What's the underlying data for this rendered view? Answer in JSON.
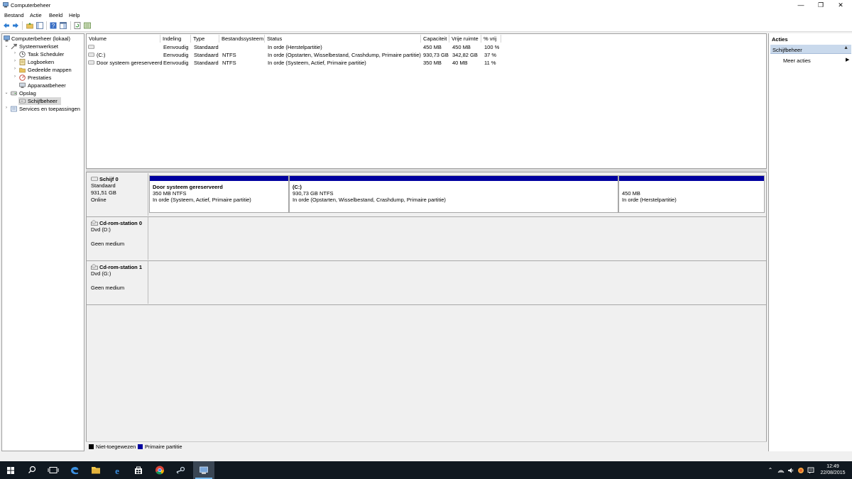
{
  "window": {
    "title": "Computerbeheer",
    "minimize_glyph": "—",
    "maximize_glyph": "❐",
    "close_glyph": "✕"
  },
  "menu": [
    "Bestand",
    "Actie",
    "Beeld",
    "Help"
  ],
  "toolbar_icons": [
    "back-arrow-icon",
    "forward-arrow-icon",
    "folder-up-icon",
    "show-hide-tree-icon",
    "help-icon",
    "properties-icon",
    "refresh-icon",
    "export-icon"
  ],
  "tree": [
    {
      "label": "Computerbeheer (lokaal)",
      "level": 0,
      "expander": "",
      "icon": "computer-management-icon"
    },
    {
      "label": "Systeemwerkset",
      "level": 1,
      "expander": "⌄",
      "icon": "system-tools-icon"
    },
    {
      "label": "Task Scheduler",
      "level": 2,
      "expander": "›",
      "icon": "clock-icon"
    },
    {
      "label": "Logboeken",
      "level": 2,
      "expander": "›",
      "icon": "event-log-icon"
    },
    {
      "label": "Gedeelde mappen",
      "level": 2,
      "expander": "›",
      "icon": "shared-folder-icon"
    },
    {
      "label": "Prestaties",
      "level": 2,
      "expander": "›",
      "icon": "performance-icon"
    },
    {
      "label": "Apparaatbeheer",
      "level": 2,
      "expander": "",
      "icon": "device-manager-icon"
    },
    {
      "label": "Opslag",
      "level": 1,
      "expander": "⌄",
      "icon": "storage-icon"
    },
    {
      "label": "Schijfbeheer",
      "level": 2,
      "expander": "",
      "icon": "disk-management-icon",
      "selected": true
    },
    {
      "label": "Services en toepassingen",
      "level": 1,
      "expander": "›",
      "icon": "services-icon"
    }
  ],
  "volumes": {
    "columns": [
      "Volume",
      "Indeling",
      "Type",
      "Bestandssysteem",
      "Status",
      "Capaciteit",
      "Vrije ruimte",
      "% vrij"
    ],
    "rows": [
      [
        "",
        "Eenvoudig",
        "Standaard",
        "",
        "In orde (Herstelpartitie)",
        "450 MB",
        "450 MB",
        "100 %"
      ],
      [
        "(C:)",
        "Eenvoudig",
        "Standaard",
        "NTFS",
        "In orde (Opstarten, Wisselbestand, Crashdump, Primaire partitie)",
        "930,73 GB",
        "342,82 GB",
        "37 %"
      ],
      [
        "Door systeem gereserveerd",
        "Eenvoudig",
        "Standaard",
        "NTFS",
        "In orde (Systeem, Actief, Primaire partitie)",
        "350 MB",
        "40 MB",
        "11 %"
      ]
    ]
  },
  "disks": [
    {
      "name": "Schijf 0",
      "type": "Standaard",
      "size": "931,51 GB",
      "state": "Online",
      "partitions": [
        {
          "title": "Door systeem gereserveerd",
          "size": "350 MB NTFS",
          "status": "In orde (Systeem, Actief, Primaire partitie)"
        },
        {
          "title": "(C:)",
          "size": "930,73 GB NTFS",
          "status": "In orde (Opstarten, Wisselbestand, Crashdump, Primaire partitie)"
        },
        {
          "title": "",
          "size": "450 MB",
          "status": "In orde (Herstelpartitie)"
        }
      ]
    },
    {
      "name": "Cd-rom-station 0",
      "type": "Dvd (D:)",
      "media": "Geen medium"
    },
    {
      "name": "Cd-rom-station 1",
      "type": "Dvd (G:)",
      "media": "Geen medium"
    }
  ],
  "legend": [
    {
      "label": "Niet-toegewezen",
      "color": "#000000"
    },
    {
      "label": "Primaire partitie",
      "color": "#00009f"
    }
  ],
  "actions": {
    "title": "Acties",
    "section": "Schijfbeheer",
    "section_glyph": "▲",
    "more": "Meer acties",
    "more_glyph": "▶"
  },
  "taskbar": {
    "icons": [
      "windows-start-icon",
      "search-icon",
      "task-view-icon",
      "edge-icon",
      "file-explorer-icon",
      "internet-explorer-icon",
      "store-icon",
      "chrome-icon",
      "steam-icon",
      "computer-management-taskbar-icon"
    ],
    "tray_icons": [
      "show-hidden-icons-chevron",
      "network-icon",
      "volume-icon",
      "keyboard-icon",
      "action-center-icon"
    ],
    "time": "12:49",
    "date": "22/08/2015"
  }
}
